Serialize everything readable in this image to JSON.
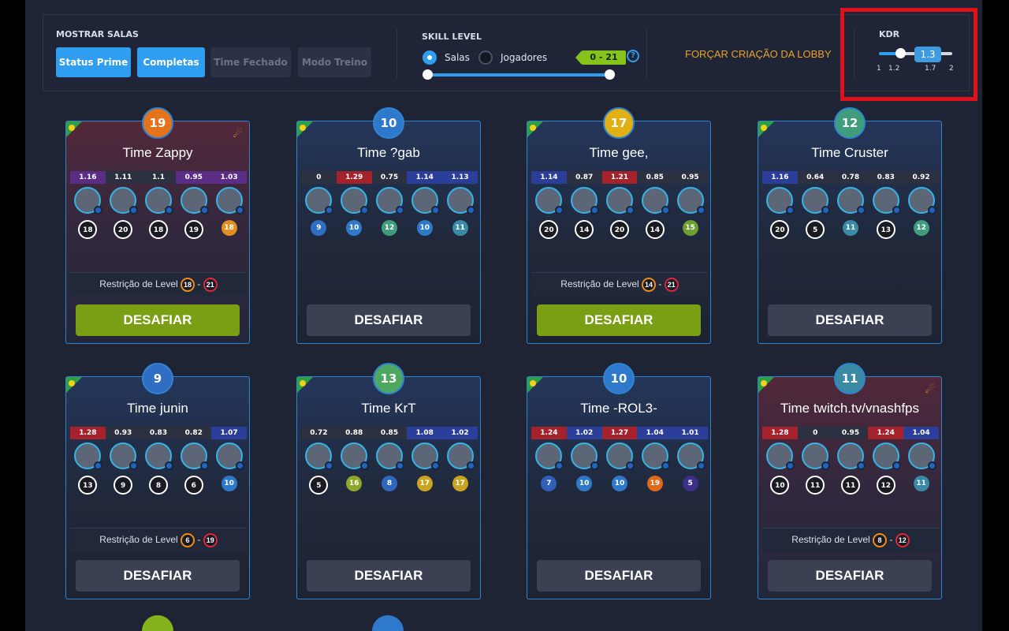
{
  "filters": {
    "title": "MOSTRAR SALAS",
    "buttons": [
      "Status Prime",
      "Completas",
      "Time Fechado",
      "Modo Treino"
    ]
  },
  "skill": {
    "title": "SKILL LEVEL",
    "opt_salas": "Salas",
    "opt_jogadores": "Jogadores",
    "range": "0 - 21",
    "help": "?"
  },
  "force_lobby": "FORÇAR CRIAÇÃO DA LOBBY",
  "kdr": {
    "title": "KDR",
    "value": "1.3",
    "ticks": [
      "1",
      "1.2",
      "1.7",
      "2"
    ]
  },
  "restrict_label": "Restrição de Level",
  "challenge_label": "DESAFIAR",
  "colors": {
    "accent": "#2f9df0",
    "green_button": "#7a9f14",
    "grey_button": "#3b4152",
    "orange_link": "#e9a22c"
  },
  "cards": [
    {
      "level": "19",
      "badge_color": "#e6721a",
      "title": "Time Zappy",
      "rocket": true,
      "style": "red",
      "btn": "green",
      "kd": [
        "1.16",
        "1.11",
        "1.1",
        "0.95",
        "1.03"
      ],
      "levels": [
        "18",
        "20",
        "18",
        "19",
        "18"
      ],
      "restrict": [
        "18",
        "21"
      ]
    },
    {
      "level": "10",
      "badge_color": "#2f79cc",
      "title": "Time ?gab",
      "rocket": false,
      "style": "blue",
      "btn": "grey",
      "kd": [
        "0",
        "1.29",
        "0.75",
        "1.14",
        "1.13"
      ],
      "levels": [
        "9",
        "10",
        "12",
        "10",
        "11"
      ],
      "restrict": null
    },
    {
      "level": "17",
      "badge_color": "#e0b015",
      "title": "Time gee,",
      "rocket": false,
      "style": "blue",
      "btn": "green",
      "kd": [
        "1.14",
        "0.87",
        "1.21",
        "0.85",
        "0.95"
      ],
      "levels": [
        "20",
        "14",
        "20",
        "14",
        "15"
      ],
      "restrict": [
        "14",
        "21"
      ]
    },
    {
      "level": "12",
      "badge_color": "#3f9c7d",
      "title": "Time Cruster",
      "rocket": false,
      "style": "blue",
      "btn": "grey",
      "kd": [
        "1.16",
        "0.64",
        "0.78",
        "0.83",
        "0.92"
      ],
      "levels": [
        "20",
        "5",
        "11",
        "13",
        "12"
      ],
      "restrict": null
    },
    {
      "level": "9",
      "badge_color": "#2f6ec3",
      "title": "Time junin",
      "rocket": false,
      "style": "blue",
      "btn": "grey",
      "kd": [
        "1.28",
        "0.93",
        "0.83",
        "0.82",
        "1.07"
      ],
      "levels": [
        "13",
        "9",
        "8",
        "6",
        "10"
      ],
      "restrict": [
        "6",
        "19"
      ]
    },
    {
      "level": "13",
      "badge_color": "#4ea862",
      "title": "Time KrT",
      "rocket": false,
      "style": "blue",
      "btn": "grey",
      "kd": [
        "0.72",
        "0.88",
        "0.85",
        "1.08",
        "1.02"
      ],
      "levels": [
        "5",
        "16",
        "8",
        "17",
        "17"
      ],
      "restrict": null
    },
    {
      "level": "10",
      "badge_color": "#2f79cc",
      "title": "Time -ROL3-",
      "rocket": false,
      "style": "blue",
      "btn": "grey",
      "kd": [
        "1.24",
        "1.02",
        "1.27",
        "1.04",
        "1.01"
      ],
      "levels": [
        "7",
        "10",
        "10",
        "19",
        "5"
      ],
      "restrict": null
    },
    {
      "level": "11",
      "badge_color": "#3a8aa5",
      "title": "Time twitch.tv/vnashfps",
      "rocket": true,
      "style": "red",
      "btn": "grey",
      "kd": [
        "1.28",
        "0",
        "0.95",
        "1.24",
        "1.04"
      ],
      "levels": [
        "10",
        "11",
        "11",
        "12",
        "11"
      ],
      "restrict": [
        "8",
        "12"
      ]
    }
  ]
}
